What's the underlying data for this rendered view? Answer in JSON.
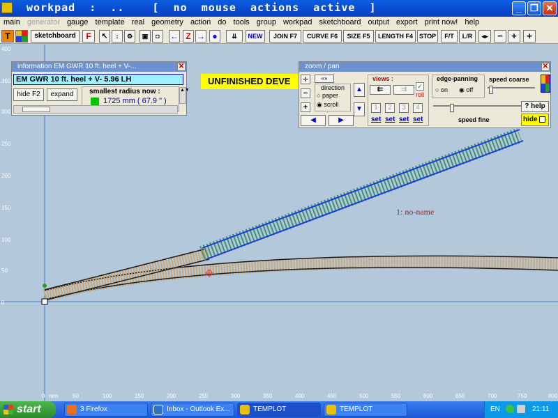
{
  "titlebar": {
    "title": "workpad  :  ..    [  no  mouse  actions  active  ]",
    "minimize": "_",
    "maximize": "❐",
    "close": "✕"
  },
  "menu": [
    "main",
    "generator",
    "gauge",
    "template",
    "real",
    "geometry",
    "action",
    "do",
    "tools",
    "group",
    "workpad",
    "sketchboard",
    "output",
    "export",
    "print now!",
    "help"
  ],
  "toolbar": {
    "t": "T",
    "sketchboard": "sketchboard",
    "f": "F",
    "z": "Z",
    "new": "NEW",
    "join": "JOIN F7",
    "curve": "CURVE F6",
    "size": "SIZE F5",
    "length": "LENGTH F4",
    "stop": "STOP",
    "ft": "F/T",
    "lr": "L/R",
    "minus": "−",
    "plus": "+"
  },
  "info_panel": {
    "title": "information   EM  GWR  10 ft. heel  +  V-...",
    "template_name": "EM  GWR  10 ft. heel  +  V- 5.96   LH",
    "hide_button": "hide  F2",
    "expand_button": "expand",
    "radius_label": "smallest radius now :",
    "radius_value": "1725 mm  ( 67.9 \" )",
    "radius_color": "#00c000"
  },
  "warning_banner": "UNFINISHED  DEVE",
  "zoom_panel": {
    "title": "zoom  /  pan",
    "direction_label": "direction",
    "paper": "paper",
    "scroll": "scroll",
    "direction_selected": "scroll",
    "views_label": "views :",
    "roll_label": "roll",
    "view_slots": [
      "1",
      "2",
      "3",
      "4"
    ],
    "set_label": "set",
    "edge_label": "edge-panning",
    "on": "on",
    "off": "off",
    "edge_selected": "off",
    "speed_coarse": "speed  coarse",
    "speed_fine": "speed  fine",
    "help": "? help",
    "hide": "hide"
  },
  "canvas": {
    "x_unit": "mm",
    "x_labels": [
      "0",
      "50",
      "100",
      "150",
      "200",
      "250",
      "300",
      "350",
      "400",
      "450",
      "500",
      "550",
      "600",
      "650",
      "700",
      "750",
      "800"
    ],
    "y_labels": [
      "400",
      "350",
      "300",
      "250",
      "200",
      "150",
      "100",
      "50",
      "0"
    ],
    "template_label": "1: no-name",
    "grid_color": "#4a78c8",
    "background": "#b4c8dc"
  },
  "taskbar": {
    "start": "start",
    "tasks": [
      "3 Firefox",
      "Inbox - Outlook Ex...",
      "TEMPLOT",
      "TEMPLOT"
    ],
    "lang": "EN",
    "clock": "21:11"
  }
}
